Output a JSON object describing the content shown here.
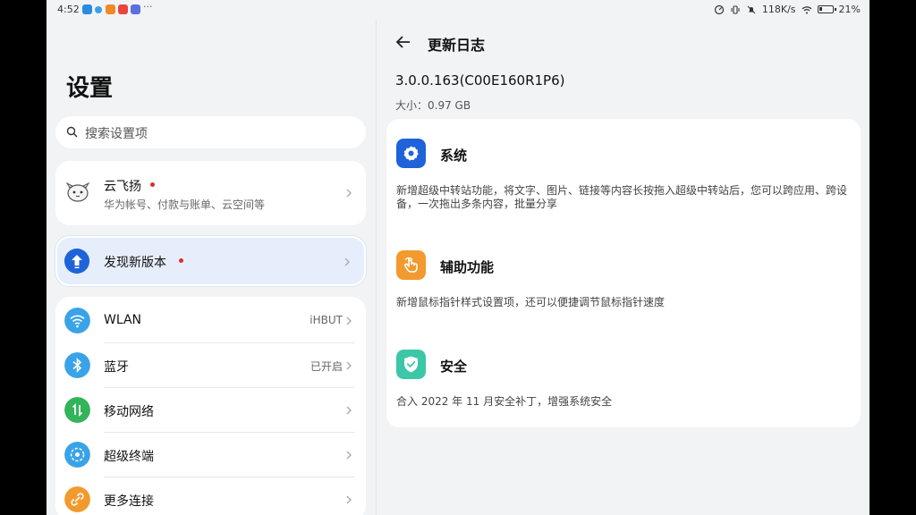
{
  "status_bar": {
    "time": "4:52",
    "dots": "···",
    "net_speed": "118K/s",
    "battery": "21%"
  },
  "settings": {
    "title": "设置",
    "search_placeholder": "搜索设置项"
  },
  "account": {
    "name": "云飞扬",
    "subtitle": "华为帐号、付款与账单、云空间等"
  },
  "update_item": {
    "label": "发现新版本"
  },
  "network_items": [
    {
      "label": "WLAN",
      "value": "iHBUT",
      "icon": "wifi-icon",
      "color": "#3aa3e8"
    },
    {
      "label": "蓝牙",
      "value": "已开启",
      "icon": "bluetooth-icon",
      "color": "#3aa3e8"
    },
    {
      "label": "移动网络",
      "value": "",
      "icon": "mobile-network-icon",
      "color": "#33b35a"
    },
    {
      "label": "超级终端",
      "value": "",
      "icon": "super-device-icon",
      "color": "#3aa3e8"
    },
    {
      "label": "更多连接",
      "value": "",
      "icon": "link-icon",
      "color": "#f29a2e"
    }
  ],
  "changelog": {
    "title": "更新日志",
    "version": "3.0.0.163(C00E160R1P6)",
    "size": "大小：0.97 GB",
    "categories": [
      {
        "title": "系统",
        "icon": "gear-icon",
        "color": "#1f63d9",
        "description": "新增超级中转站功能，将文字、图片、链接等内容长按拖入超级中转站后，您可以跨应用、跨设备，一次拖出多条内容，批量分享"
      },
      {
        "title": "辅助功能",
        "icon": "hand-pointer-icon",
        "color": "#f29a2e",
        "description": "新增鼠标指针样式设置项，还可以便捷调节鼠标指针速度"
      },
      {
        "title": "安全",
        "icon": "shield-check-icon",
        "color": "#3cc7a8",
        "description": "合入 2022 年 11 月安全补丁，增强系统安全"
      }
    ]
  }
}
